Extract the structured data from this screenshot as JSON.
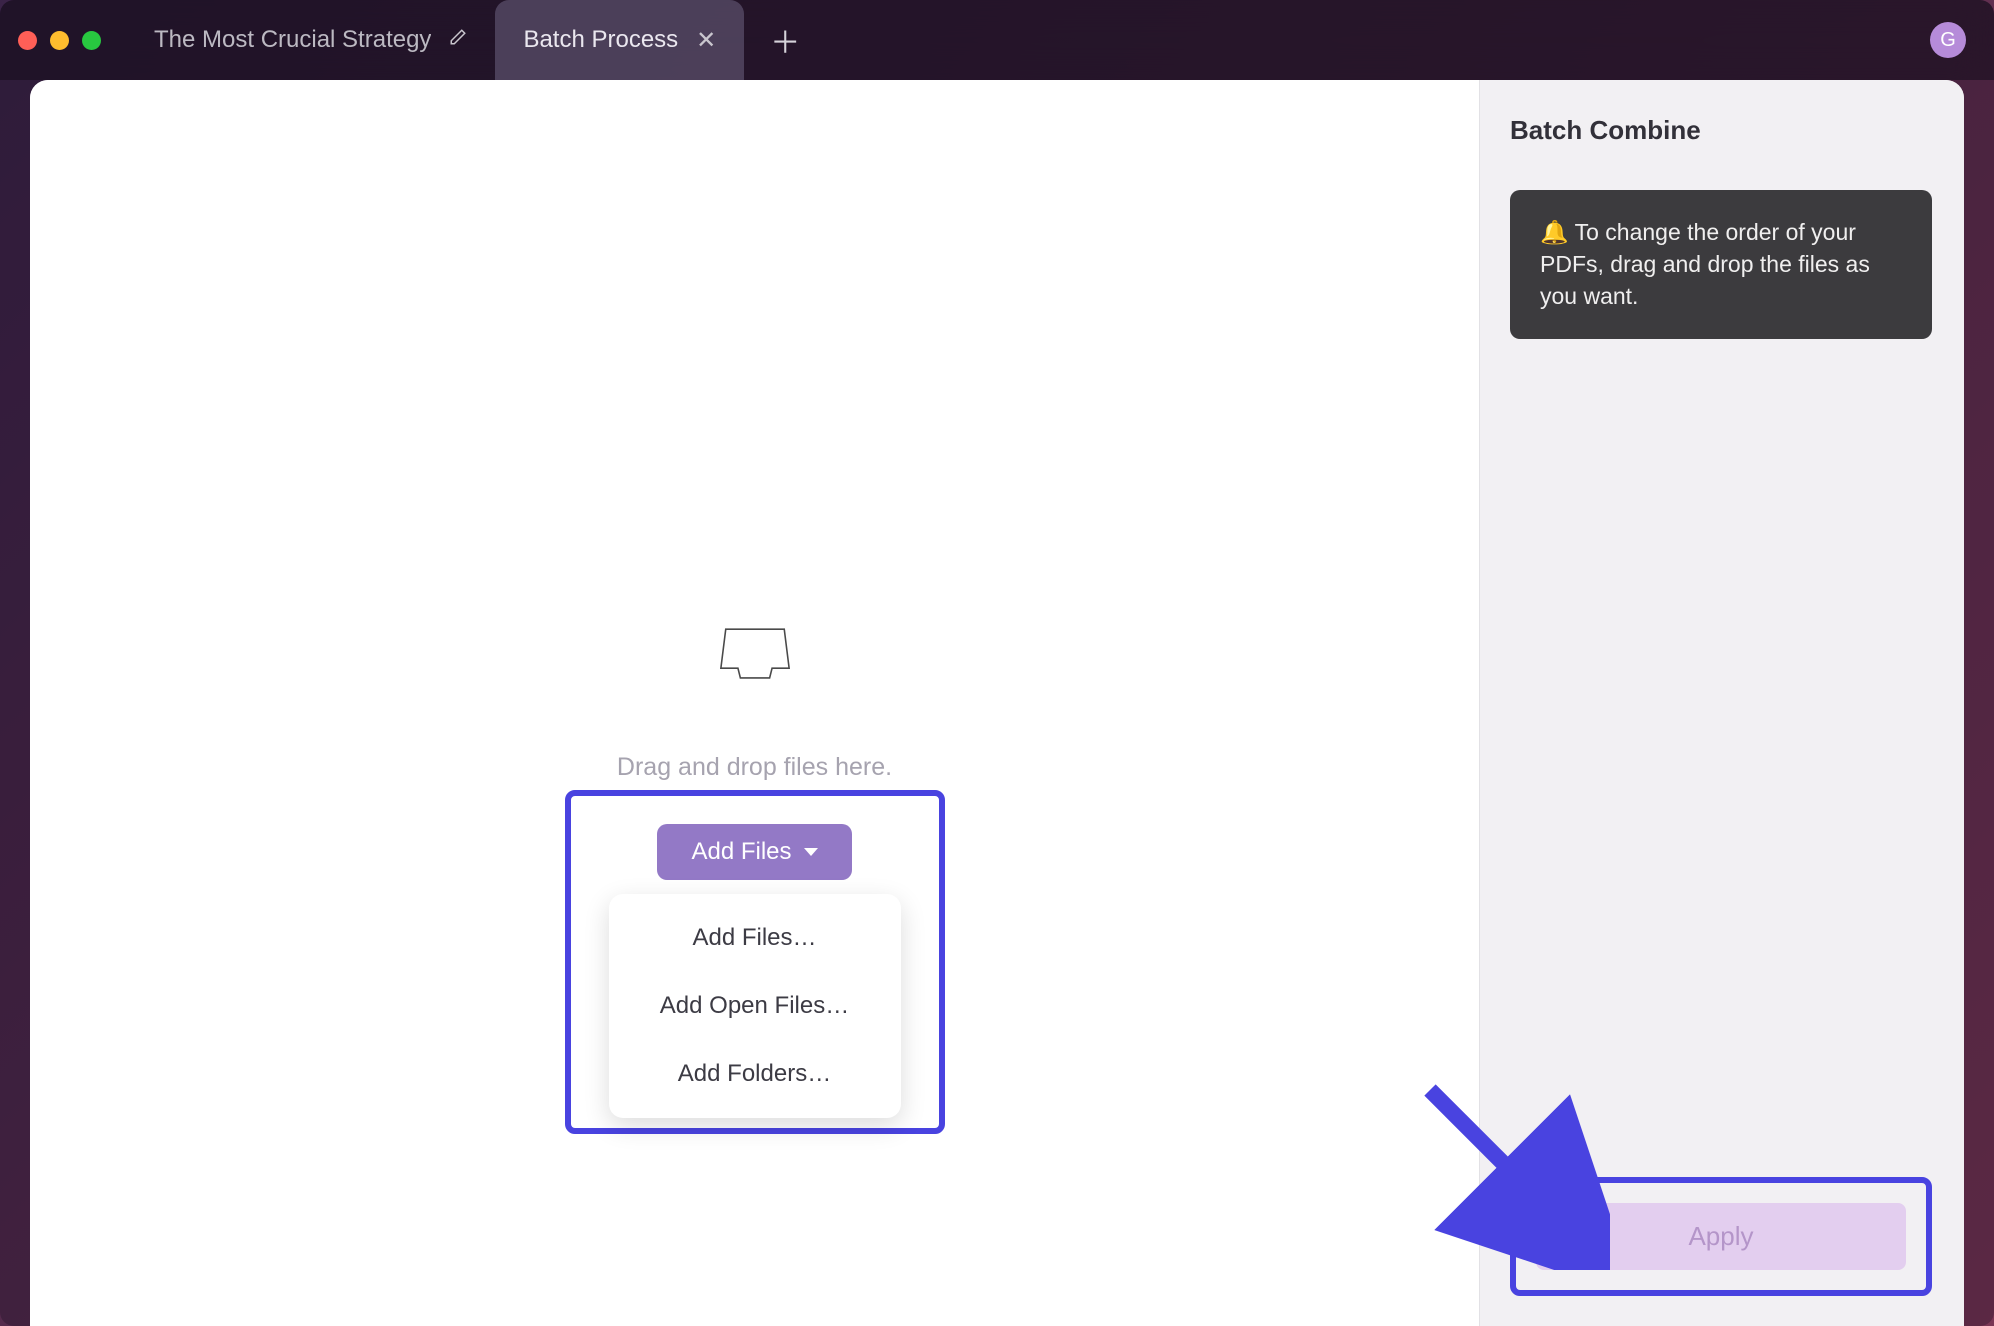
{
  "titlebar": {
    "tabs": [
      {
        "title": "The Most Crucial Strategy",
        "active": false
      },
      {
        "title": "Batch Process",
        "active": true
      }
    ],
    "avatar_initial": "G"
  },
  "main": {
    "drop_hint": "Drag and drop files here.",
    "add_files_button": "Add Files",
    "dropdown": {
      "items": [
        "Add Files…",
        "Add Open Files…",
        "Add Folders…"
      ]
    }
  },
  "sidebar": {
    "title": "Batch Combine",
    "tip": "🔔 To change the order of your PDFs, drag and drop the files as you want.",
    "apply_label": "Apply"
  }
}
